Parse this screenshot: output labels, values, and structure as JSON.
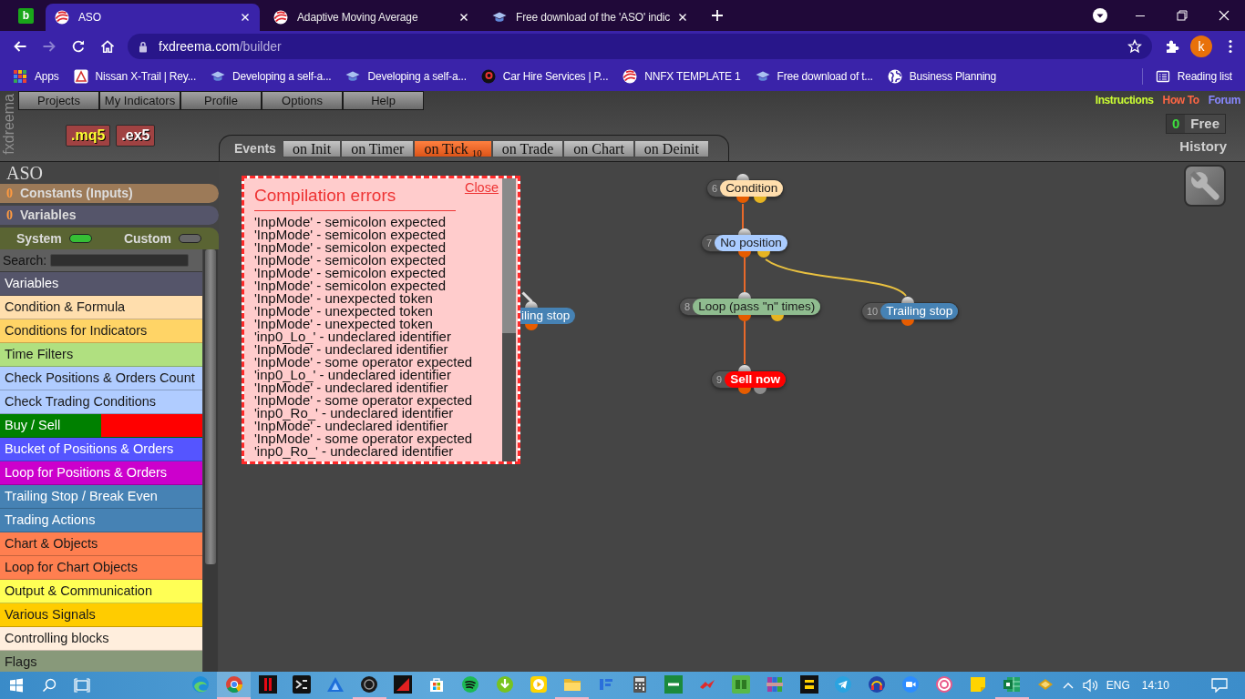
{
  "browser": {
    "app_badge": "b",
    "tabs": [
      {
        "title": "ASO",
        "selected": true
      },
      {
        "title": "Adaptive Moving Average",
        "selected": false
      },
      {
        "title": "Free download of the 'ASO' indic",
        "selected": false
      }
    ],
    "navigation": {
      "can_go_forward": false
    },
    "address": {
      "host": "fxdreema.com",
      "path": "/builder"
    },
    "profile_initial": "k",
    "bookmarks": [
      "Apps",
      "Nissan X-Trail | Rey...",
      "Developing a self-a...",
      "Developing a self-a...",
      "Car Hire Services | P...",
      "NNFX TEMPLATE 1",
      "Free download of t...",
      "Business Planning"
    ],
    "reading_list": "Reading list"
  },
  "header": {
    "logo": "fxdreema",
    "menu": [
      "Projects",
      "My Indicators",
      "Profile",
      "Options",
      "Help"
    ],
    "file_buttons": [
      {
        "label": ".mq5",
        "kind": "source"
      },
      {
        "label": ".ex5",
        "kind": "compiled"
      }
    ],
    "events_label": "Events",
    "event_tabs": [
      {
        "label": "on Init",
        "selected": false
      },
      {
        "label": "on Timer",
        "selected": false
      },
      {
        "label": "on Tick",
        "count": "10",
        "selected": true
      },
      {
        "label": "on Trade",
        "selected": false
      },
      {
        "label": "on Chart",
        "selected": false
      },
      {
        "label": "on Deinit",
        "selected": false
      }
    ],
    "links": [
      {
        "label": "Instructions",
        "color": "#ccff33"
      },
      {
        "label": "How To",
        "color": "#ff6644"
      },
      {
        "label": "Forum",
        "color": "#8888ff"
      }
    ],
    "credits": {
      "count": "0",
      "plan": "Free"
    },
    "history": "History"
  },
  "sidebar": {
    "project": "ASO",
    "sections": [
      {
        "count": "0",
        "label": "Constants (Inputs)",
        "color": "#9c7a58"
      },
      {
        "count": "0",
        "label": "Variables",
        "color": "#55556a"
      }
    ],
    "toggles": [
      {
        "label": "System",
        "on": true
      },
      {
        "label": "Custom",
        "on": false
      }
    ],
    "search_label": "Search:",
    "items": [
      {
        "label": "Variables",
        "color": "#55556a"
      },
      {
        "label": "Condition & Formula",
        "color": "#ffdead"
      },
      {
        "label": "Conditions for Indicators",
        "color": "#ffd466"
      },
      {
        "label": "Time Filters",
        "color": "#b0e080"
      },
      {
        "label": "Check Positions & Orders Count",
        "color": "#b0ccff"
      },
      {
        "label": "Check Trading Conditions",
        "color": "#b0ccff"
      },
      {
        "label": "Buy / Sell",
        "color": "#008000",
        "right_part": {
          "color": "#ff0000"
        }
      },
      {
        "label": "Bucket of Positions & Orders",
        "color": "#5555ff"
      },
      {
        "label": "Loop for Positions & Orders",
        "color": "#cc00cc"
      },
      {
        "label": "Trailing Stop / Break Even",
        "color": "#4682b4"
      },
      {
        "label": "Trading Actions",
        "color": "#4682b4"
      },
      {
        "label": "Chart & Objects",
        "color": "#ff7f50"
      },
      {
        "label": "Loop for Chart Objects",
        "color": "#ff7f50"
      },
      {
        "label": "Output & Communication",
        "color": "#ffff55"
      },
      {
        "label": "Various Signals",
        "color": "#ffcc00"
      },
      {
        "label": "Controlling blocks",
        "color": "#ffeedd"
      },
      {
        "label": "Flags",
        "color": "#88997a"
      }
    ]
  },
  "canvas": {
    "nodes": [
      {
        "kind": "block",
        "number": "6",
        "label": "Condition",
        "color": "#ffdead",
        "outputs": [
          {
            "color": "#e65c00"
          },
          {
            "color": "#e6b422"
          }
        ]
      },
      {
        "kind": "block",
        "number": "7",
        "label": "No position",
        "color": "#aaccff",
        "outputs": [
          {
            "color": "#e65c00"
          },
          {
            "color": "#e6b422"
          }
        ]
      },
      {
        "kind": "partial",
        "label": "iling stop",
        "color": "#4682b4",
        "outputs": [
          {
            "color": "#e65c00"
          }
        ]
      },
      {
        "kind": "block",
        "number": "8",
        "label": "Loop (pass \"n\" times)",
        "color": "#8fbc8f",
        "outputs": [
          {
            "color": "#e65c00"
          },
          {
            "color": "#e6b422"
          }
        ]
      },
      {
        "kind": "block",
        "number": "10",
        "label": "Trailing stop",
        "color": "#4682b4",
        "outputs": [
          {
            "color": "#e65c00"
          }
        ]
      },
      {
        "kind": "action",
        "number": "9",
        "label": "Sell now",
        "color": "#ff0000",
        "outputs": [
          {
            "color": "#e65c00"
          },
          {
            "color": "#8c8c8c"
          }
        ]
      }
    ],
    "connections": [
      {
        "color": "#e8692a"
      },
      {
        "color": "#e8692a"
      },
      {
        "color": "#e8c040"
      },
      {
        "color": "#e8692a"
      },
      {
        "color": "#dddddd"
      }
    ],
    "dialog": {
      "title": "Compilation errors",
      "close": "Close",
      "errors": [
        "'InpMode' - semicolon expected",
        "'InpMode' - semicolon expected",
        "'InpMode' - semicolon expected",
        "'InpMode' - semicolon expected",
        "'InpMode' - semicolon expected",
        "'InpMode' - semicolon expected",
        "'InpMode' - unexpected token",
        "'InpMode' - unexpected token",
        "'InpMode' - unexpected token",
        "'inp0_Lo_' - undeclared identifier",
        "'InpMode' - undeclared identifier",
        "'InpMode' - some operator expected",
        "'inp0_Lo_' - undeclared identifier",
        "'InpMode' - undeclared identifier",
        "'InpMode' - some operator expected",
        "'inp0_Ro_' - undeclared identifier",
        "'InpMode' - undeclared identifier",
        "'InpMode' - some operator expected",
        "'inp0_Ro_' - undeclared identifier"
      ]
    }
  },
  "taskbar": {
    "apps": [
      {
        "running": false,
        "selected": false
      },
      {
        "running": true,
        "selected": true
      },
      {
        "running": false,
        "selected": false
      },
      {
        "running": false,
        "selected": false
      },
      {
        "running": false,
        "selected": false
      },
      {
        "running": true,
        "selected": false
      },
      {
        "running": false,
        "selected": false
      },
      {
        "running": false,
        "selected": false
      },
      {
        "running": false,
        "selected": false
      },
      {
        "running": false,
        "selected": false
      },
      {
        "running": false,
        "selected": false
      },
      {
        "running": true,
        "selected": false
      },
      {
        "running": false,
        "selected": false
      },
      {
        "running": false,
        "selected": false
      },
      {
        "running": false,
        "selected": false
      },
      {
        "running": false,
        "selected": false
      },
      {
        "running": false,
        "selected": false
      },
      {
        "running": false,
        "selected": false
      },
      {
        "running": false,
        "selected": false
      },
      {
        "running": false,
        "selected": false
      },
      {
        "running": false,
        "selected": false
      },
      {
        "running": false,
        "selected": false
      },
      {
        "running": false,
        "selected": false
      },
      {
        "running": false,
        "selected": false
      },
      {
        "running": true,
        "selected": false
      },
      {
        "running": false,
        "selected": false
      }
    ],
    "language": "ENG",
    "time": "14:10"
  }
}
